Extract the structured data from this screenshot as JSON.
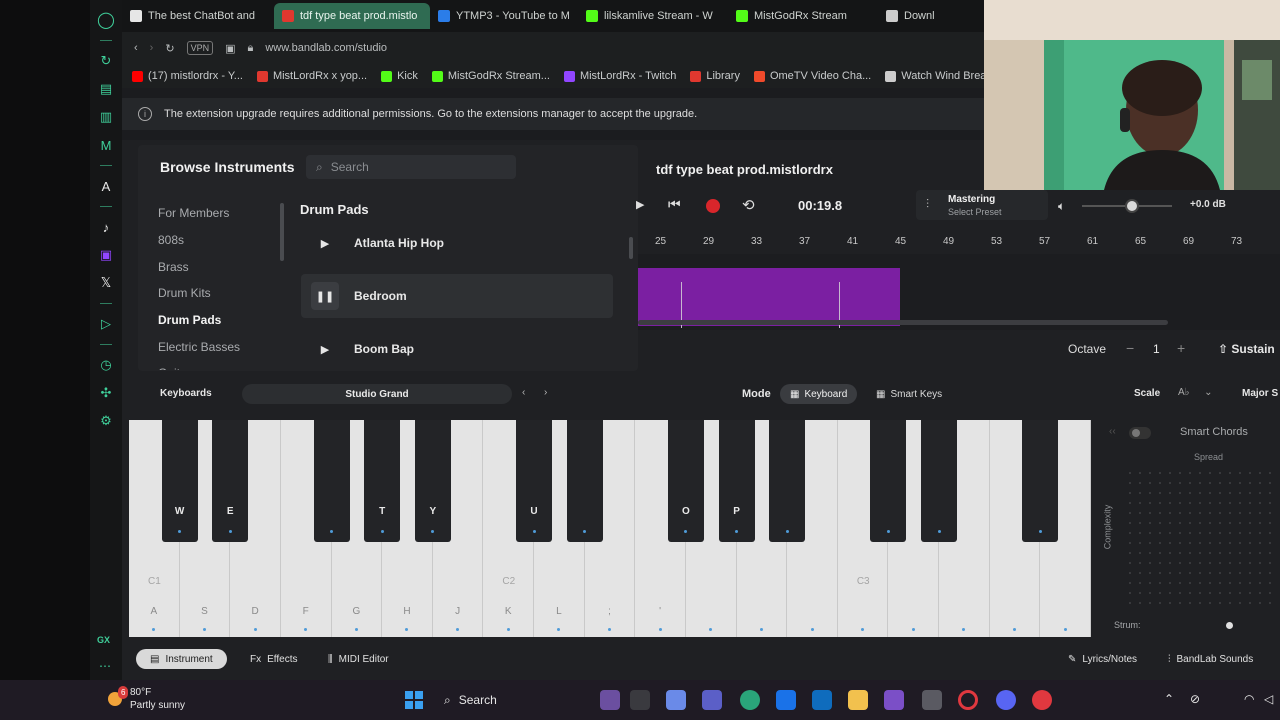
{
  "browser": {
    "tabs": [
      {
        "label": "The best ChatBot and",
        "color": "#e6e6e6",
        "icon": "chatbot-icon"
      },
      {
        "label": "tdf type beat prod.mistlo",
        "color": "#e0382f",
        "icon": "bandlab-icon",
        "active": true
      },
      {
        "label": "YTMP3 - YouTube to M",
        "color": "#2b7de9",
        "icon": "ytmp3-icon"
      },
      {
        "label": "lilskamlive Stream - W",
        "color": "#53fc18",
        "icon": "kick-icon"
      },
      {
        "label": "MistGodRx Stream",
        "color": "#53fc18",
        "icon": "kick-icon"
      },
      {
        "label": "Downl",
        "color": "#cccccc",
        "icon": "download-icon"
      }
    ],
    "url": "www.bandlab.com/studio",
    "vpn": "VPN",
    "bookmarks": [
      {
        "label": "(17) mistlordrx - Y...",
        "color": "#ff0000",
        "icon": "youtube-icon"
      },
      {
        "label": "MistLordRx x yop...",
        "color": "#e0382f",
        "icon": "bandlab-icon"
      },
      {
        "label": "Kick",
        "color": "#53fc18",
        "icon": "kick-icon"
      },
      {
        "label": "MistGodRx Stream...",
        "color": "#53fc18",
        "icon": "kick-icon"
      },
      {
        "label": "MistLordRx - Twitch",
        "color": "#9146ff",
        "icon": "twitch-icon"
      },
      {
        "label": "Library",
        "color": "#e0382f",
        "icon": "bandlab-icon"
      },
      {
        "label": "OmeTV Video Cha...",
        "color": "#f04a2b",
        "icon": "ometv-icon"
      },
      {
        "label": "Watch Wind Brea",
        "color": "#cccccc",
        "icon": "globe-icon"
      }
    ],
    "infobar": "The extension upgrade requires additional permissions. Go to the extensions manager to accept the upgrade."
  },
  "browse": {
    "title": "Browse Instruments",
    "search_placeholder": "Search",
    "categories": [
      "For Members",
      "808s",
      "Brass",
      "Drum Kits",
      "Drum Pads",
      "Electric Basses",
      "Guitars"
    ],
    "active_category": "Drum Pads",
    "section_title": "Drum Pads",
    "pads": [
      {
        "name": "Atlanta Hip Hop",
        "state": "play"
      },
      {
        "name": "Bedroom",
        "state": "pause"
      },
      {
        "name": "Boom Bap",
        "state": "play"
      }
    ]
  },
  "project": {
    "title": "tdf type beat prod.mistlordrx",
    "time": "00:19.8",
    "mastering_title": "Mastering",
    "mastering_sub": "Select Preset",
    "db": "+0.0 dB",
    "volume_level": 0.55,
    "ruler": [
      "25",
      "29",
      "33",
      "37",
      "41",
      "45",
      "49",
      "53",
      "57",
      "61",
      "65",
      "69",
      "73"
    ]
  },
  "octave": {
    "label": "Octave",
    "value": "1",
    "minus": "−",
    "plus": "+",
    "sustain": "Sustain"
  },
  "keyboard_toolbar": {
    "label": "Keyboards",
    "preset": "Studio Grand",
    "mode_label": "Mode",
    "modes": [
      {
        "label": "Keyboard",
        "active": true
      },
      {
        "label": "Smart Keys",
        "active": false
      }
    ],
    "scale_label": "Scale",
    "scale_value": "A♭",
    "scale_type": "Major S"
  },
  "piano": {
    "white_keys": [
      "A",
      "S",
      "D",
      "F",
      "G",
      "H",
      "J",
      "K",
      "L",
      ";",
      "'",
      "",
      "",
      "",
      "",
      "",
      "",
      "",
      ""
    ],
    "black_keys": [
      "W",
      "E",
      "",
      "T",
      "Y",
      "U",
      "",
      "O",
      "P",
      "",
      "",
      "",
      "",
      "",
      ""
    ],
    "octave_labels": [
      {
        "label": "C1",
        "key": 0
      },
      {
        "label": "C2",
        "key": 7
      },
      {
        "label": "C3",
        "key": 14
      }
    ]
  },
  "smart_chords": {
    "title": "Smart Chords",
    "spread": "Spread",
    "complexity": "Complexity",
    "strum": "Strum:"
  },
  "bottom_tabs": {
    "instrument": "Instrument",
    "effects": "Effects",
    "midi": "MIDI Editor",
    "lyrics": "Lyrics/Notes",
    "sounds": "BandLab Sounds"
  },
  "taskbar": {
    "temp": "80°F",
    "weather": "Partly sunny",
    "search": "Search",
    "badge": "6"
  },
  "colors": {
    "accent_purple": "#7b1fa2",
    "record_red": "#d8262b",
    "opera_green": "#3fcf9a"
  }
}
